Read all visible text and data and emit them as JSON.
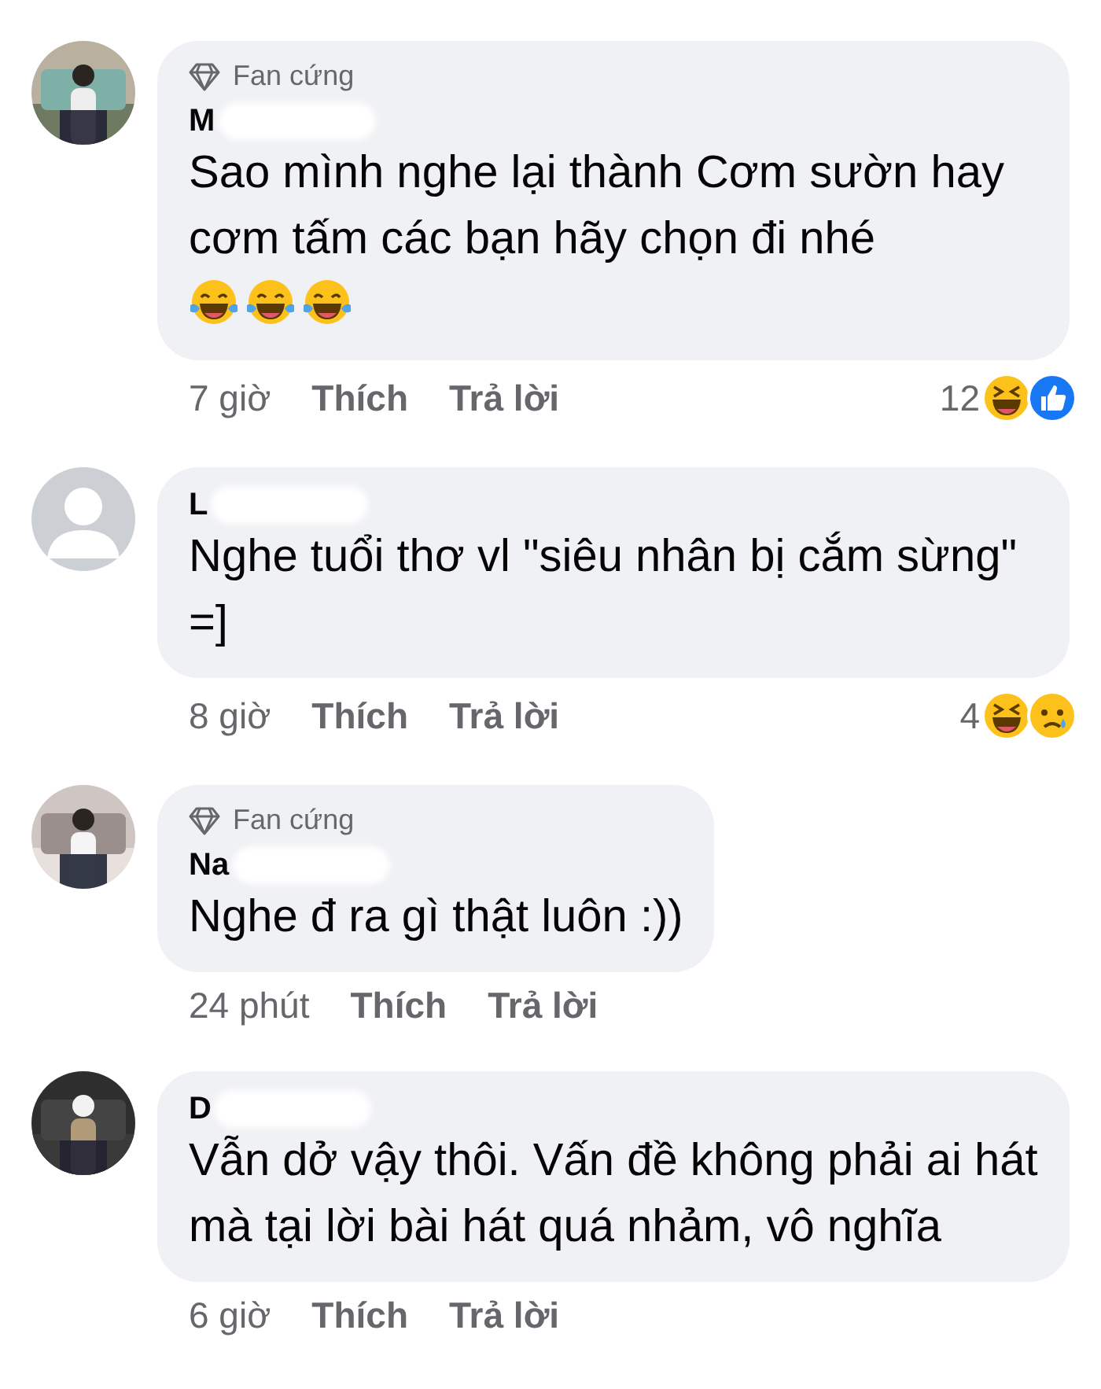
{
  "comments": [
    {
      "avatar": {
        "kind": "picture"
      },
      "badge": "Fan cứng",
      "name": "M",
      "text": "Sao mình nghe lại thành Cơm sườn hay cơm tấm các bạn hãy chọn đi nhé",
      "emojis": [
        {
          "kind": "joy"
        },
        {
          "kind": "joy"
        },
        {
          "kind": "joy"
        }
      ],
      "time": "7 giờ",
      "like": "Thích",
      "reply": "Trả lời",
      "reaction_count": "12",
      "reactions": [
        {
          "kind": "haha"
        },
        {
          "kind": "like"
        }
      ]
    },
    {
      "avatar": {
        "kind": "default"
      },
      "name": "L",
      "text": "Nghe tuổi thơ vl \"siêu nhân bị cắm sừng\" =]",
      "time": "8 giờ",
      "like": "Thích",
      "reply": "Trả lời",
      "reaction_count": "4",
      "reactions": [
        {
          "kind": "haha"
        },
        {
          "kind": "sad"
        }
      ]
    },
    {
      "avatar": {
        "kind": "picture"
      },
      "badge": "Fan cứng",
      "name": "Na",
      "text": "Nghe đ ra gì thật luôn :))",
      "time": "24 phút",
      "like": "Thích",
      "reply": "Trả lời"
    },
    {
      "avatar": {
        "kind": "picture"
      },
      "name": "D",
      "text": "Vẫn dở vậy thôi. Vấn đề không phải ai hát mà tại lời bài hát quá nhảm, vô nghĩa",
      "time": "6 giờ",
      "like": "Thích",
      "reply": "Trả lời"
    }
  ]
}
